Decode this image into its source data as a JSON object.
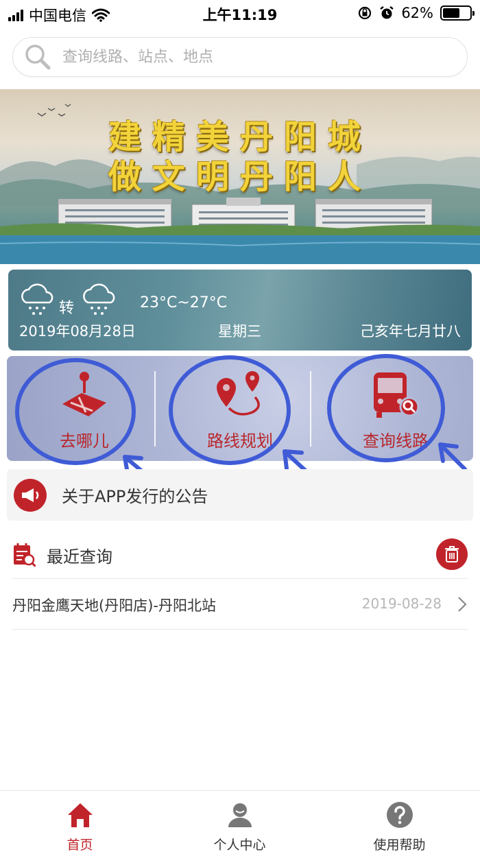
{
  "status_bar": {
    "carrier": "中国电信",
    "time": "上午11:19",
    "battery": "62%",
    "battery_level": 0.62
  },
  "search": {
    "placeholder": "查询线路、站点、地点"
  },
  "banner": {
    "line1": "建精美丹阳城",
    "line2": "做文明丹阳人"
  },
  "weather": {
    "transition": "转",
    "temperature": "23°C~27°C",
    "date": "2019年08月28日",
    "weekday": "星期三",
    "lunar_date": "己亥年七月廿八",
    "icon_from": "cloud-rain-icon",
    "icon_to": "cloud-rain-icon"
  },
  "quick_actions": [
    {
      "label": "去哪儿",
      "icon": "map-pin-icon"
    },
    {
      "label": "路线规划",
      "icon": "route-plan-icon"
    },
    {
      "label": "查询线路",
      "icon": "bus-search-icon"
    }
  ],
  "notice": {
    "text": "关于APP发行的公告"
  },
  "recent": {
    "title": "最近查询",
    "items": [
      {
        "route": "丹阳金鹰天地(丹阳店)-丹阳北站",
        "date": "2019-08-28"
      }
    ]
  },
  "tabbar": {
    "tabs": [
      {
        "label": "首页",
        "icon": "home-icon",
        "active": true
      },
      {
        "label": "个人中心",
        "icon": "person-icon",
        "active": false
      },
      {
        "label": "使用帮助",
        "icon": "help-icon",
        "active": false
      }
    ]
  },
  "colors": {
    "brand_red": "#c0242a",
    "annotation_blue": "#3f5bd6"
  }
}
